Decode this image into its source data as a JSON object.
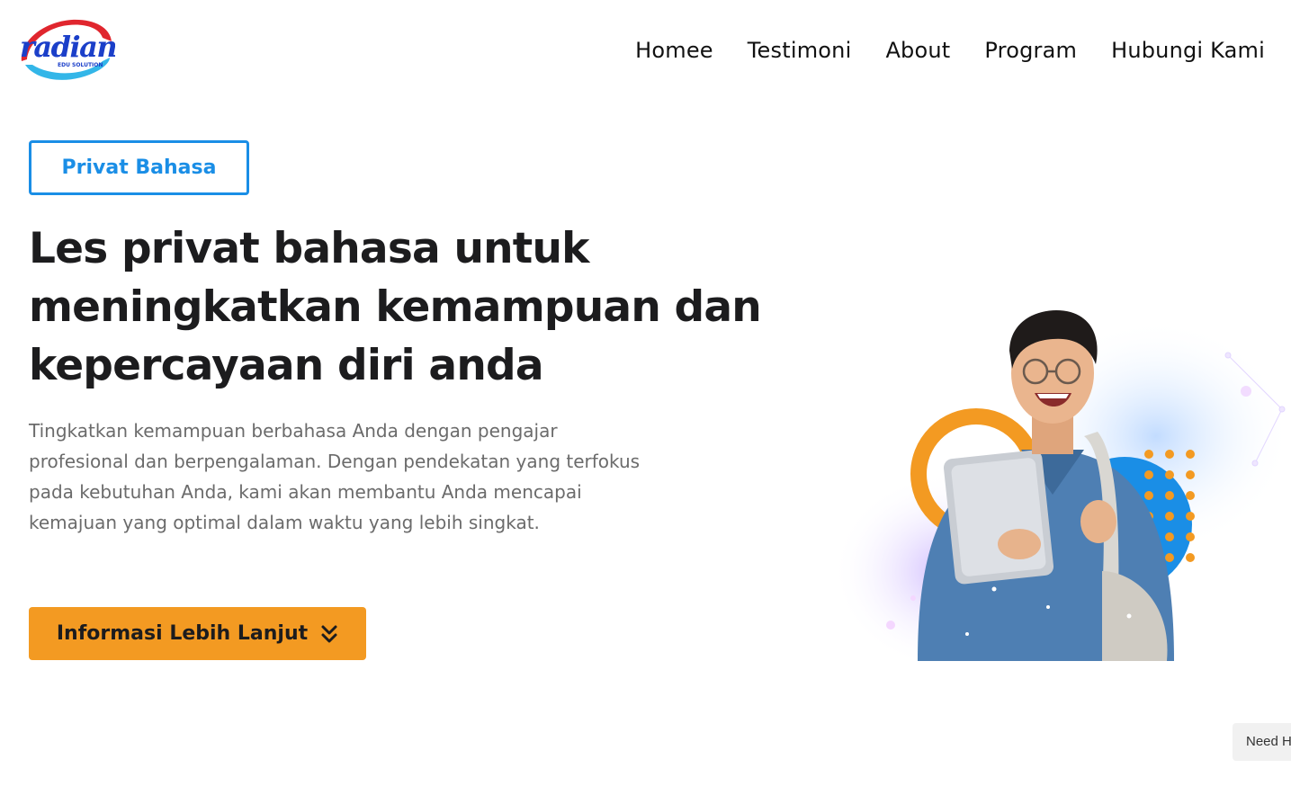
{
  "header": {
    "logo": {
      "wordmark": "radian",
      "tagline": "EDU SOLUTION",
      "colors": {
        "blue": "#1b3fc9",
        "red": "#e0262e",
        "cyan": "#33b6e8"
      }
    },
    "nav": [
      {
        "label": "Homee"
      },
      {
        "label": "Testimoni"
      },
      {
        "label": "About"
      },
      {
        "label": "Program"
      },
      {
        "label": "Hubungi Kami"
      }
    ]
  },
  "hero": {
    "tag_label": "Privat Bahasa",
    "headline_lines": [
      "Les privat bahasa untuk",
      "meningkatkan kemampuan dan",
      "kepercayaan diri anda"
    ],
    "description": "Tingkatkan kemampuan berbahasa Anda dengan pengajar profesional dan berpengalaman. Dengan pendekatan yang terfokus pada kebutuhan Anda, kami akan membantu Anda mencapai kemajuan yang optimal dalam waktu yang lebih singkat.",
    "cta_label": "Informasi Lebih Lanjut",
    "cta_icon": "double-chevron-down-icon"
  },
  "help_chip": {
    "label": "Need He"
  },
  "colors": {
    "accent_blue": "#1a8ee6",
    "cta_orange": "#f39a22",
    "heading": "#1c1c1e",
    "body_text": "#6b6b6b"
  }
}
